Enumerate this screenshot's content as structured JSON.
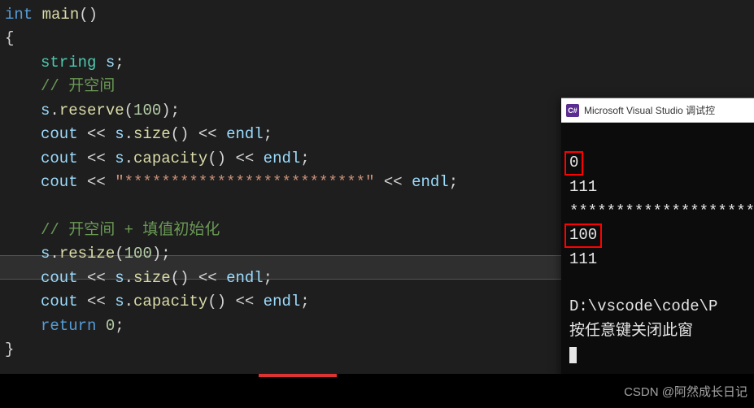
{
  "code": {
    "l1_kw": "int",
    "l1_fn": "main",
    "l1_pun": "()",
    "l2": "{",
    "l3_type": "string",
    "l3_id": "s",
    "l3_pun": ";",
    "l4_cmt": "// 开空间",
    "l5_id": "s",
    "l5_dot": ".",
    "l5_fn": "reserve",
    "l5_open": "(",
    "l5_num": "100",
    "l5_close": ");",
    "l6_id": "cout",
    "l6_op1": " << ",
    "l6_s": "s",
    "l6_dot": ".",
    "l6_fn": "size",
    "l6_call": "()",
    "l6_op2": " << ",
    "l6_endl": "endl",
    "l6_semi": ";",
    "l7_id": "cout",
    "l7_op1": " << ",
    "l7_s": "s",
    "l7_dot": ".",
    "l7_fn": "capacity",
    "l7_call": "()",
    "l7_op2": " << ",
    "l7_endl": "endl",
    "l7_semi": ";",
    "l8_id": "cout",
    "l8_op1": " << ",
    "l8_str": "\"**************************\"",
    "l8_op2": " << ",
    "l8_endl": "endl",
    "l8_semi": ";",
    "l10_cmt": "// 开空间 + 填值初始化",
    "l11_id": "s",
    "l11_dot": ".",
    "l11_fn": "resize",
    "l11_open": "(",
    "l11_num": "100",
    "l11_close": ");",
    "l12_id": "cout",
    "l12_op1": " << ",
    "l12_s": "s",
    "l12_dot": ".",
    "l12_fn": "size",
    "l12_call": "()",
    "l12_op2": " << ",
    "l12_endl": "endl",
    "l12_semi": ";",
    "l13_id": "cout",
    "l13_op1": " << ",
    "l13_s": "s",
    "l13_dot": ".",
    "l13_fn": "capacity",
    "l13_call": "()",
    "l13_op2": " << ",
    "l13_endl": "endl",
    "l13_semi": ";",
    "l14_kw": "return",
    "l14_sp": " ",
    "l14_num": "0",
    "l14_semi": ";",
    "l15": "}"
  },
  "console": {
    "title_icon_text": "C#",
    "title": "Microsoft Visual Studio 调试控",
    "out1": "0",
    "out2": "111",
    "out3": "********************",
    "out4": "100",
    "out5": "111",
    "blank": "",
    "out6": "D:\\vscode\\code\\P",
    "out7": "按任意键关闭此窗"
  },
  "watermark": "CSDN @阿然成长日记"
}
